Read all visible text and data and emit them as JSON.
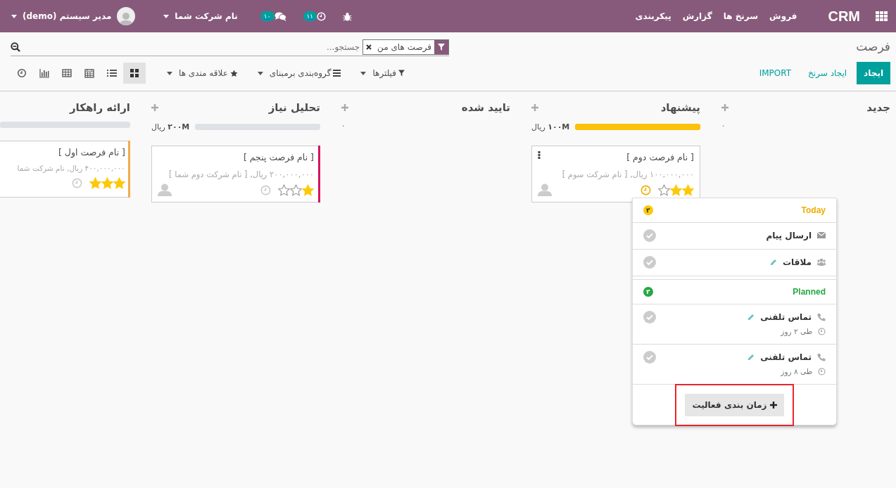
{
  "navbar": {
    "app_name": "CRM",
    "menu": [
      "فروش",
      "سرنخ ها",
      "گزارش",
      "پیکربندی"
    ],
    "activity_count": "۱۱",
    "message_count": "۱۰",
    "company": "نام شرکت شما",
    "user": "مدیر سیستم (demo)"
  },
  "breadcrumb": "فرصت",
  "search": {
    "facets": [
      {
        "label": "فرصت های من"
      }
    ],
    "placeholder": "جستجو..."
  },
  "buttons": [
    {
      "label": "ایجاد",
      "kind": "primary"
    },
    {
      "label": "ایجاد سرنخ",
      "kind": "link"
    },
    {
      "label": "IMPORT",
      "kind": "link"
    }
  ],
  "filters": [
    {
      "label": "فیلترها",
      "kind": "filter"
    },
    {
      "label": "گروه‌بندی برمبنای",
      "kind": "group"
    },
    {
      "label": "علاقه مندی ها",
      "kind": "favorite"
    }
  ],
  "views": [
    {
      "kind": "kanban",
      "selected": true
    },
    {
      "kind": "list",
      "selected": false
    },
    {
      "kind": "calendar",
      "selected": false
    },
    {
      "kind": "pivot",
      "selected": false
    },
    {
      "kind": "graph",
      "selected": false
    },
    {
      "kind": "activity",
      "selected": false
    }
  ],
  "columns": [
    {
      "title": "جدید",
      "sum": "۰"
    },
    {
      "title": "پیشنهاد",
      "sum": "۱۰۰M",
      "currency": "ریال",
      "level": 1,
      "cards": [
        {
          "title": "[ نام فرصت دوم ]",
          "subtitle": "۱۰۰,۰۰۰,۰۰۰ ریال, [ نام شرکت سوم ]",
          "stars": 2,
          "activity_today": true,
          "menu_visible": true,
          "avatar": true
        }
      ]
    },
    {
      "title": "تایید شده",
      "sum": "۰"
    },
    {
      "title": "تحلیل نیاز",
      "sum": "۲۰۰M",
      "currency": "ریال",
      "level": 0,
      "cards": [
        {
          "title": "[ نام فرصت پنجم ]",
          "subtitle": "۲۰۰,۰۰۰,۰۰۰ ریال, [ نام شرکت دوم شما ]",
          "stars": 1,
          "activity_today": false,
          "avatar": true,
          "color": "#d6145f"
        }
      ]
    },
    {
      "title": "ارائه راهکار",
      "level": 0,
      "cards": [
        {
          "title": "[ نام فرصت اول ]",
          "subtitle": "۴۰۰,۰۰۰,۰۰۰ ریال, نام شرکت شما",
          "stars": 3,
          "activity_today": false,
          "color": "#f0ad4e"
        }
      ]
    }
  ],
  "popover": {
    "sections": [
      {
        "title": "Today",
        "count": "۲",
        "kind": "today",
        "items": [
          {
            "title": "ارسال پیام",
            "kind": "email",
            "editable": false
          },
          {
            "title": "ملاقات",
            "kind": "meeting",
            "editable": true
          }
        ]
      },
      {
        "title": "Planned",
        "count": "۲",
        "kind": "planned",
        "items": [
          {
            "title": "تماس تلفنی",
            "kind": "call",
            "editable": true,
            "due": "طی ۲ روز"
          },
          {
            "title": "تماس تلفنی",
            "kind": "call",
            "editable": true,
            "due": "طی ۸ روز"
          }
        ]
      }
    ],
    "button": {
      "label": "زمان بندی فعالیت",
      "highlighted": true
    }
  }
}
